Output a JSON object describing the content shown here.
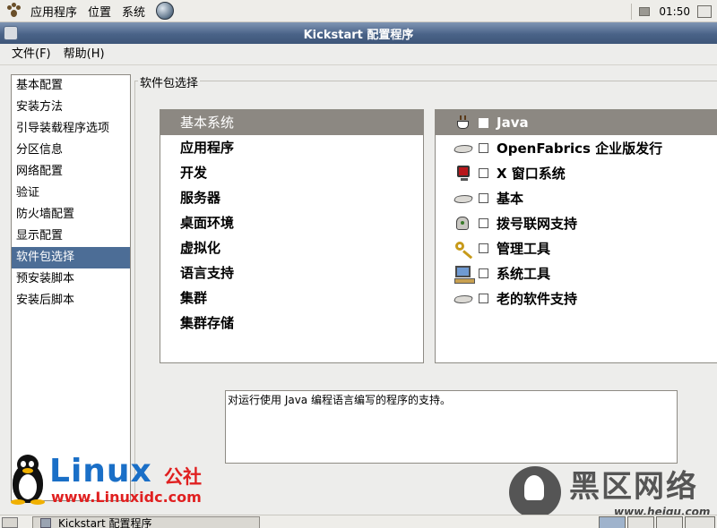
{
  "top_panel": {
    "menus": [
      "应用程序",
      "位置",
      "系统"
    ],
    "clock": "01:50"
  },
  "window": {
    "title": "Kickstart 配置程序"
  },
  "menubar": {
    "items": [
      "文件(F)",
      "帮助(H)"
    ]
  },
  "nav": {
    "items": [
      "基本配置",
      "安装方法",
      "引导装载程序选项",
      "分区信息",
      "网络配置",
      "验证",
      "防火墙配置",
      "显示配置",
      "软件包选择",
      "预安装脚本",
      "安装后脚本"
    ],
    "selected_index": 8
  },
  "packages": {
    "frame_label": "软件包选择",
    "categories": [
      "基本系统",
      "应用程序",
      "开发",
      "服务器",
      "桌面环境",
      "虚拟化",
      "语言支持",
      "集群",
      "集群存储"
    ],
    "selected_category": 0,
    "groups": [
      {
        "icon": "coffee-cup-icon",
        "label": "Java",
        "checked": false
      },
      {
        "icon": "disk-icon",
        "label": "OpenFabrics 企业版发行",
        "checked": false
      },
      {
        "icon": "monitor-icon",
        "label": "X 窗口系统",
        "checked": false
      },
      {
        "icon": "disk-icon",
        "label": "基本",
        "checked": false
      },
      {
        "icon": "phone-icon",
        "label": "拨号联网支持",
        "checked": false
      },
      {
        "icon": "keys-icon",
        "label": "管理工具",
        "checked": false
      },
      {
        "icon": "computer-icon",
        "label": "系统工具",
        "checked": false
      },
      {
        "icon": "disk-icon",
        "label": "老的软件支持",
        "checked": false
      }
    ],
    "selected_group": 0,
    "description": "对运行使用 Java 编程语言编写的程序的支持。"
  },
  "watermarks": {
    "linux_text": "Linux",
    "linux_cn": "公社",
    "linux_url": "www.Linuxidc.com",
    "heiqu_cn": "黑区网络",
    "heiqu_url": "www.heiqu.com"
  },
  "taskbar": {
    "task_label": "Kickstart 配置程序"
  },
  "colors": {
    "selection_blue": "#4c6d96",
    "selection_gray": "#8c8882",
    "titlebar_blue": "#4a6388"
  }
}
